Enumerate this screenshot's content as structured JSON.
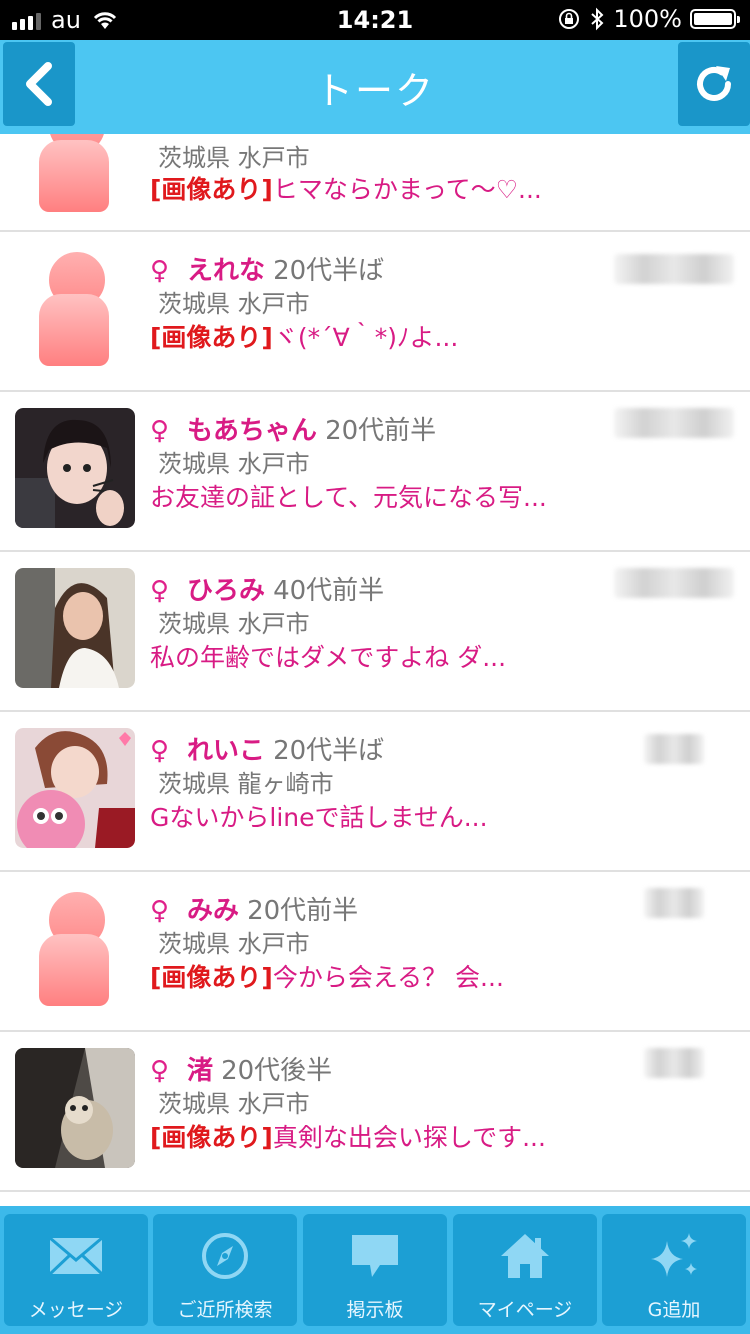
{
  "status_bar": {
    "carrier": "au",
    "time": "14:21",
    "battery": "100%",
    "battery_level": 1.0
  },
  "header": {
    "title": "トーク",
    "back_icon": "chevron-left-icon",
    "refresh_icon": "refresh-icon"
  },
  "colors": {
    "header_bg": "#4cc6f2",
    "header_button_bg": "#1a96c9",
    "tabbar_bg": "#3cb9ea",
    "name_pink": "#d81b84",
    "image_tag_red": "#e0191d"
  },
  "talks": [
    {
      "sex": "",
      "name": "",
      "age": "",
      "location": "茨城県 水戸市",
      "tag": "[画像あり]",
      "message": "ヒマならかまって〜♡...",
      "avatar": "default"
    },
    {
      "sex": "♀",
      "name": "えれな",
      "age": "20代半ば",
      "location": "茨城県 水戸市",
      "tag": "[画像あり]",
      "message": "ヾ(*´∀｀*)ﾉよ...",
      "avatar": "default"
    },
    {
      "sex": "♀",
      "name": "もあちゃん",
      "age": "20代前半",
      "location": "茨城県 水戸市",
      "tag": "",
      "message": "お友達の証として、元気になる写...",
      "avatar": "photo"
    },
    {
      "sex": "♀",
      "name": "ひろみ",
      "age": "40代前半",
      "location": "茨城県 水戸市",
      "tag": "",
      "message": "私の年齢ではダメですよね ダ...",
      "avatar": "photo"
    },
    {
      "sex": "♀",
      "name": "れいこ",
      "age": "20代半ば",
      "location": "茨城県 龍ヶ崎市",
      "tag": "",
      "message": "Gないからlineで話しません...",
      "avatar": "photo"
    },
    {
      "sex": "♀",
      "name": "みみ",
      "age": "20代前半",
      "location": "茨城県 水戸市",
      "tag": "[画像あり]",
      "message": "今から会える？ 会...",
      "avatar": "default"
    },
    {
      "sex": "♀",
      "name": "渚",
      "age": "20代後半",
      "location": "茨城県 水戸市",
      "tag": "[画像あり]",
      "message": "真剣な出会い探しです...",
      "avatar": "photo"
    }
  ],
  "tabs": [
    {
      "label": "メッセージ",
      "icon": "envelope-icon"
    },
    {
      "label": "ご近所検索",
      "icon": "compass-icon"
    },
    {
      "label": "掲示板",
      "icon": "speech-bubble-icon"
    },
    {
      "label": "マイページ",
      "icon": "home-icon"
    },
    {
      "label": "G追加",
      "icon": "sparkle-icon"
    }
  ]
}
